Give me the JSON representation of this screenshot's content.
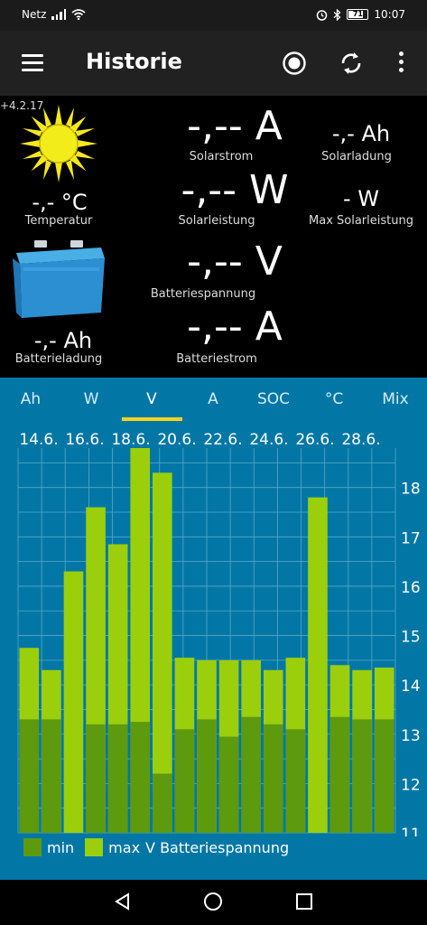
{
  "status_bar": {
    "carrier": "Netz",
    "battery_level": "71",
    "time": "10:07",
    "icons": [
      "signal-icon",
      "wifi-icon",
      "alarm-icon",
      "bluetooth-icon",
      "battery-icon"
    ]
  },
  "toolbar": {
    "title": "Historie",
    "icons": [
      "menu-icon",
      "record-icon",
      "refresh-icon",
      "more-icon"
    ]
  },
  "dashboard": {
    "version": "+4.2.17",
    "temperature": {
      "value": "-,- °C",
      "label": "Temperatur"
    },
    "battery_charge": {
      "value": "-,- Ah",
      "label": "Batterieladung"
    },
    "solar_current": {
      "value": "-,-- A",
      "label": "Solarstrom"
    },
    "solar_charge": {
      "value": "-,- Ah",
      "label": "Solarladung"
    },
    "solar_power": {
      "value": "-,-- W",
      "label": "Solarleistung"
    },
    "max_solar_power": {
      "value": "- W",
      "label": "Max Solarleistung"
    },
    "battery_voltage": {
      "value": "-,-- V",
      "label": "Batteriespannung"
    },
    "battery_current": {
      "value": "-,-- A",
      "label": "Batteriestrom"
    }
  },
  "history": {
    "tabs": [
      "Ah",
      "W",
      "V",
      "A",
      "SOC",
      "°C",
      "Mix"
    ],
    "selected_tab": "V",
    "date_labels": [
      "14.6.",
      "16.6.",
      "18.6.",
      "20.6.",
      "22.6.",
      "24.6.",
      "26.6.",
      "28.6."
    ],
    "legend": {
      "min_label": "min",
      "max_label": "max",
      "series_label": "V Batteriespannung"
    }
  },
  "chart_data": {
    "type": "bar",
    "ylim": [
      11,
      18.8
    ],
    "y_ticks": [
      "11",
      "12",
      "13",
      "14",
      "15",
      "16",
      "17",
      "18"
    ],
    "series": [
      {
        "name": "min",
        "values": [
          13.3,
          13.3,
          11.0,
          13.2,
          13.2,
          13.25,
          12.2,
          13.1,
          13.3,
          12.95,
          13.35,
          13.2,
          13.1,
          11.0,
          13.35,
          13.3,
          13.3
        ]
      },
      {
        "name": "max",
        "values": [
          14.75,
          14.3,
          16.3,
          17.6,
          16.85,
          18.8,
          18.3,
          14.55,
          14.5,
          14.5,
          14.5,
          14.3,
          14.55,
          17.8,
          14.4,
          14.3,
          14.35
        ]
      }
    ],
    "colors": {
      "min": "#5e9a0d",
      "max": "#9bcf0c",
      "background": "#0277a6",
      "grid": "#5aa7c7"
    }
  },
  "nav_bar": {
    "icons": [
      "back-icon",
      "home-icon",
      "recents-icon"
    ]
  }
}
